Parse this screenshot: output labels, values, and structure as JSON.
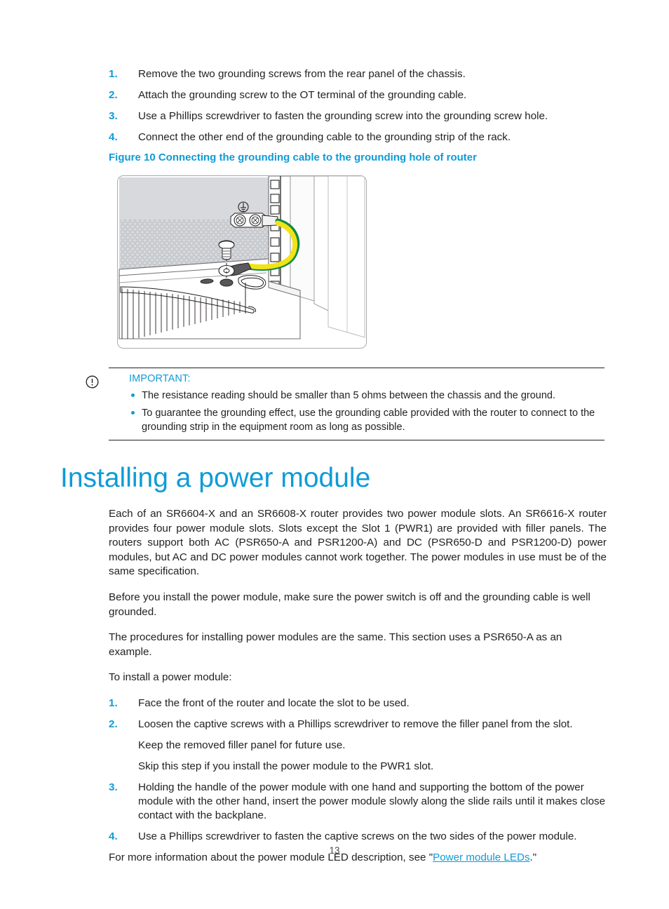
{
  "theme": {
    "accent": "#0e9bd8",
    "text": "#231f20",
    "rule": "#231f20",
    "figure_border": "#a9abae",
    "cable_yellow": "#f2e317",
    "cable_green": "#0f8a4a",
    "panel_gray": "#d7d9dc"
  },
  "top_steps": [
    {
      "num": "1.",
      "text": "Remove the two grounding screws from the rear panel of the chassis."
    },
    {
      "num": "2.",
      "text": "Attach the grounding screw to the OT terminal of the grounding cable."
    },
    {
      "num": "3.",
      "text": "Use a Phillips screwdriver to fasten the grounding screw into the grounding screw hole."
    },
    {
      "num": "4.",
      "text": "Connect the other end of the grounding cable to the grounding strip of the rack."
    }
  ],
  "figure": {
    "caption": "Figure 10 Connecting the grounding cable to the grounding hole of router",
    "alt": "Illustration of a router chassis rear showing the grounding cable routed from the rack rail to the grounding screw hole on the chassis"
  },
  "note": {
    "icon": "important-icon",
    "title": "IMPORTANT:",
    "items": [
      "The resistance reading should be smaller than 5 ohms between the chassis and the ground.",
      "To guarantee the grounding effect, use the grounding cable provided with the router to connect to the grounding strip in the equipment room as long as possible."
    ]
  },
  "section": {
    "heading": "Installing a power module",
    "paragraphs": [
      "Each of an SR6604-X and an SR6608-X router provides two power module slots. An SR6616-X router provides four power module slots. Slots except the Slot 1 (PWR1) are provided with filler panels. The routers support both AC (PSR650-A and PSR1200-A) and DC (PSR650-D and PSR1200-D) power modules, but AC and DC power modules cannot work together. The power modules in use must be of the same specification.",
      "Before you install the power module, make sure the power switch is off and the grounding cable is well grounded.",
      "The procedures for installing power modules are the same. This section uses a PSR650-A as an example.",
      "To install a power module:"
    ],
    "steps": [
      {
        "num": "1.",
        "text": "Face the front of the router and locate the slot to be used."
      },
      {
        "num": "2.",
        "text": "Loosen the captive screws with a Phillips screwdriver to remove the filler panel from the slot."
      },
      {
        "num": "3.",
        "text": "Holding the handle of the power module with one hand and supporting the bottom of the power module with the other hand, insert the power module slowly along the slide rails until it makes close contact with the backplane."
      },
      {
        "num": "4.",
        "text": "Use a Phillips screwdriver to fasten the captive screws on the two sides of the power module."
      }
    ],
    "step2_sublines": [
      "Keep the removed filler panel for future use.",
      "Skip this step if you install the power module to the PWR1 slot."
    ],
    "closing": {
      "before": "For more information about the power module LED description, see \"",
      "link": "Power module LEDs",
      "after": ".\""
    }
  },
  "footer": {
    "page_number": "13"
  }
}
